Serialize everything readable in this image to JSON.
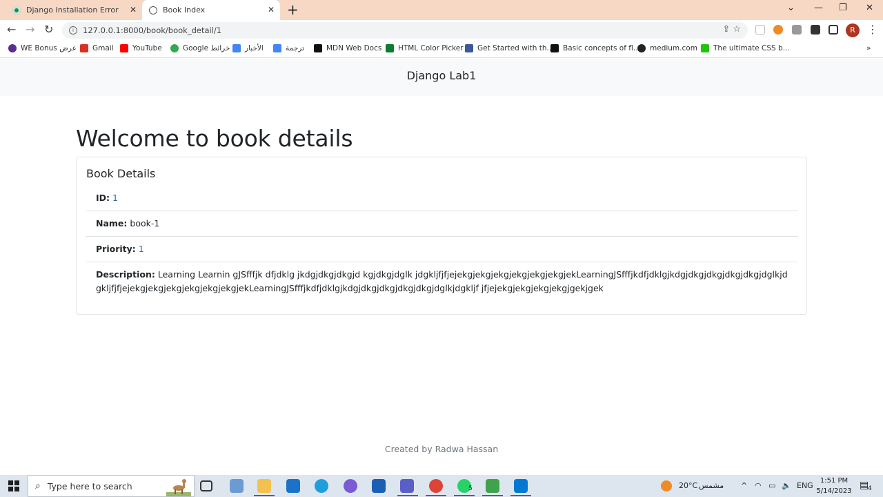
{
  "browser": {
    "tabs": [
      {
        "title": "Django Installation Error",
        "active": false
      },
      {
        "title": "Book Index",
        "active": true
      }
    ],
    "url": "127.0.0.1:8000/book/book_detail/1",
    "profile_initial": "R",
    "bookmarks": [
      {
        "label": "WE Bonus عرض",
        "color": "#5c2d91"
      },
      {
        "label": "Gmail",
        "color": "#d93025"
      },
      {
        "label": "YouTube",
        "color": "#ff0000"
      },
      {
        "label": "Google خرائط",
        "color": "#34a853"
      },
      {
        "label": "الأخبار",
        "color": "#4285f4"
      },
      {
        "label": "ترجمة",
        "color": "#4285f4"
      },
      {
        "label": "MDN Web Docs",
        "color": "#111111"
      },
      {
        "label": "HTML Color Picker",
        "color": "#0a7d2e"
      },
      {
        "label": "Get Started with th...",
        "color": "#3b5998"
      },
      {
        "label": "Basic concepts of fl...",
        "color": "#111111"
      },
      {
        "label": "medium.com",
        "color": "#222222"
      },
      {
        "label": "The ultimate CSS b...",
        "color": "#22c40a"
      }
    ]
  },
  "page": {
    "brand": "Django Lab1",
    "heading": "Welcome to book details",
    "card_title": "Book Details",
    "fields": {
      "id_label": "ID:",
      "id_value": "1",
      "name_label": "Name:",
      "name_value": "book-1",
      "priority_label": "Priority:",
      "priority_value": "1",
      "description_label": "Description:",
      "description_value": "Learning Learnin gJSfffjk dfjdklg jkdgjdkgjdkgjd kgjdkgjdglk jdgkljfjfjejekgjekgjekgjekgjekgjekgjekLearningJSfffjkdfjdklgjkdgjdkgjdkgjdkgjdkgjdglkjdgkljfjfjejekgjekgjekgjekgjekgjekgjekLearningJSfffjkdfjdklgjkdgjdkgjdkgjdkgjdkgjdglkjdgkljf jfjejekgjekgjekgjekgjgekjgek"
    },
    "footer": "Created by Radwa Hassan"
  },
  "taskbar": {
    "search_placeholder": "Type here to search",
    "weather_temp": "20°C",
    "weather_text": "مشمس",
    "language": "ENG",
    "time": "1:51 PM",
    "date": "5/14/2023",
    "whatsapp_badge": "5",
    "notifications_badge": "4"
  },
  "colors": {
    "tab_strip": "#f7d8c5",
    "navbar_bg": "#f8f9fa",
    "link_blue": "#2b6cb0"
  }
}
